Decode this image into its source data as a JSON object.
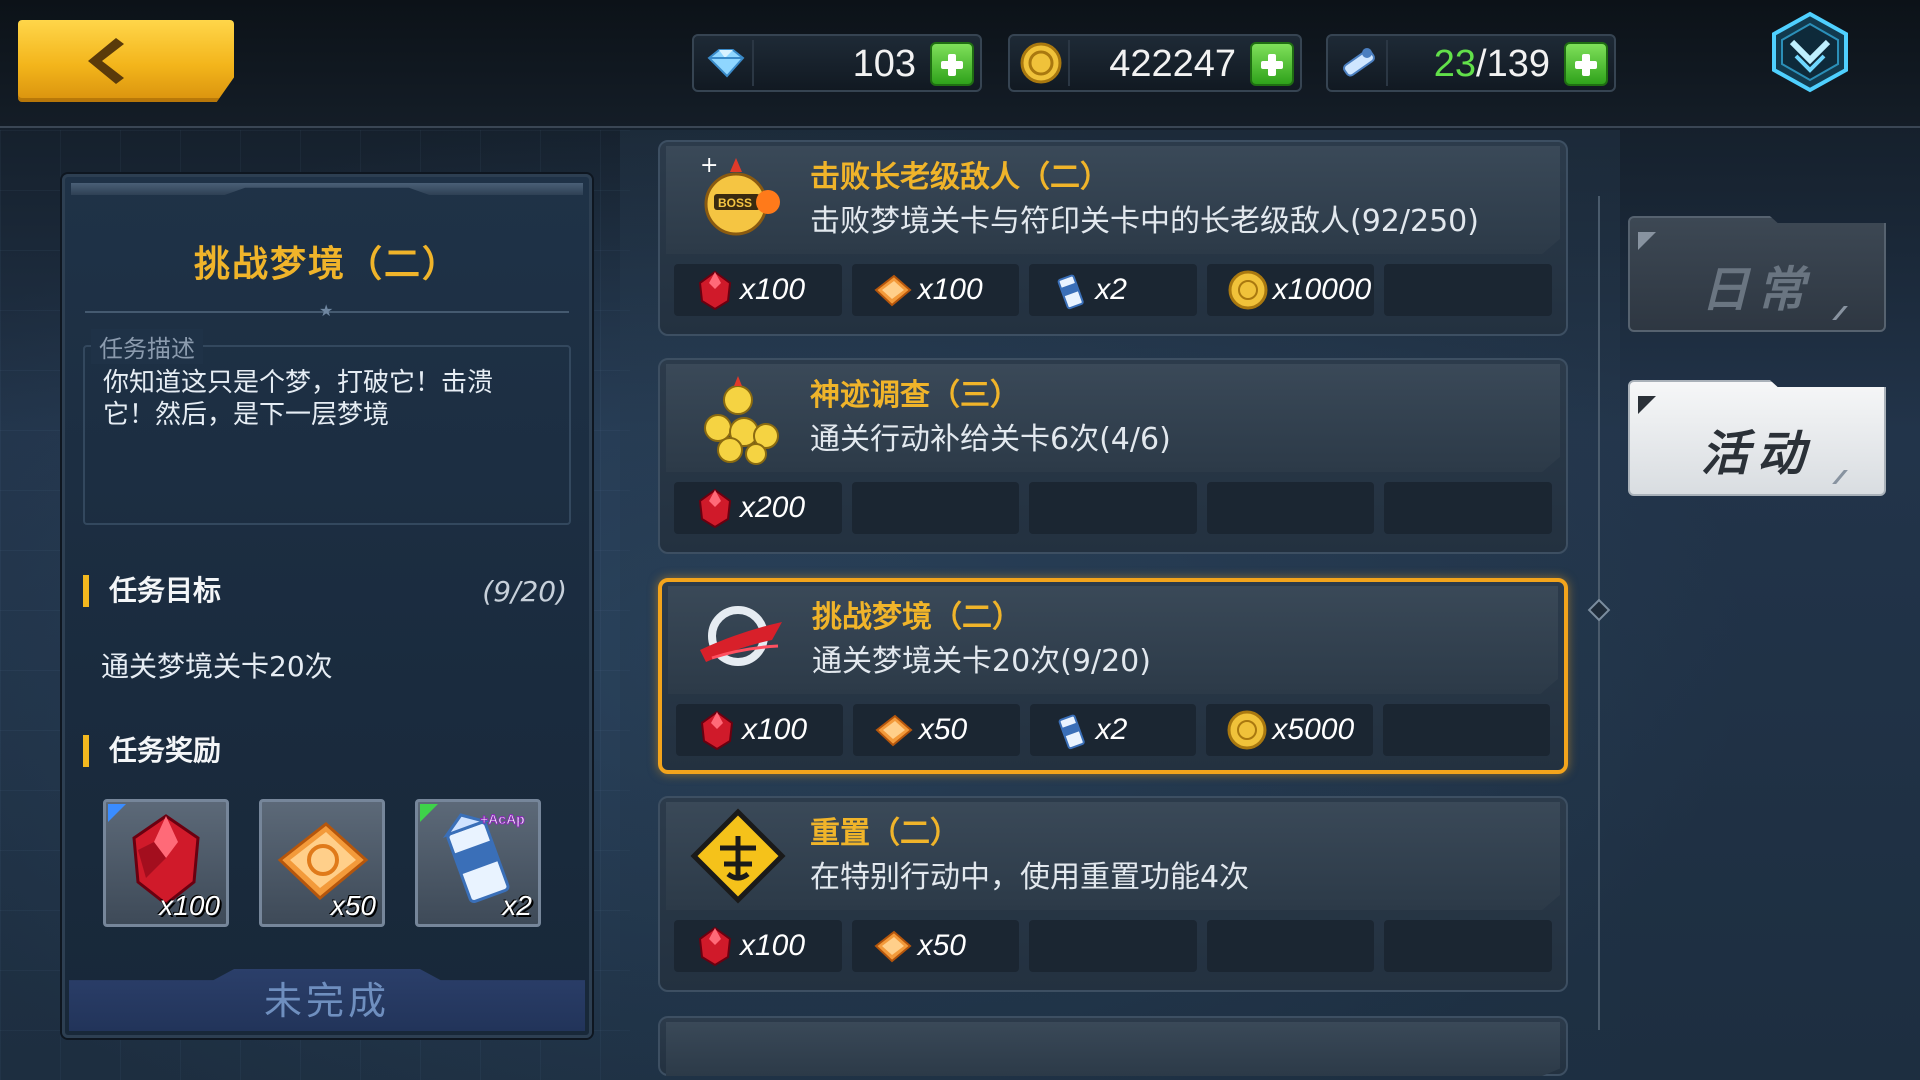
{
  "topbar": {
    "resources": [
      {
        "icon": "crystal-icon",
        "value": "103"
      },
      {
        "icon": "coin-icon",
        "value": "422247"
      },
      {
        "icon": "stamina-icon",
        "current": "23",
        "max": "/139"
      }
    ]
  },
  "detail": {
    "title": "挑战梦境（二）",
    "desc_label": "任务描述",
    "desc_text": "你知道这只是个梦，打破它！击溃它！然后，是下一层梦境",
    "goal_heading": "任务目标",
    "goal_progress": "(9/20)",
    "goal_text": "通关梦境关卡20次",
    "reward_heading": "任务奖励",
    "rewards": [
      {
        "icon": "red-crystal-icon",
        "qty": "x100"
      },
      {
        "icon": "exp-card-icon",
        "qty": "x50"
      },
      {
        "icon": "milk-carton-icon",
        "qty": "x2"
      }
    ],
    "status": "未完成"
  },
  "quests": [
    {
      "name": "击败长老级敌人（二）",
      "desc": "击败梦境关卡与符印关卡中的长老级敌人(92/250)",
      "icon": "boss-chick-icon",
      "rewards": [
        {
          "icon": "red-crystal-icon",
          "qty": "x100"
        },
        {
          "icon": "exp-card-icon",
          "qty": "x100"
        },
        {
          "icon": "milk-carton-icon",
          "qty": "x2"
        },
        {
          "icon": "coin-icon",
          "qty": "x10000"
        }
      ]
    },
    {
      "name": "神迹调查（三）",
      "desc": "通关行动补给关卡6次(4/6)",
      "icon": "chick-pile-icon",
      "rewards": [
        {
          "icon": "red-crystal-icon",
          "qty": "x200"
        }
      ]
    },
    {
      "name": "挑战梦境（二）",
      "desc": "通关梦境关卡20次(9/20)",
      "icon": "slash-orb-icon",
      "rewards": [
        {
          "icon": "red-crystal-icon",
          "qty": "x100"
        },
        {
          "icon": "exp-card-icon",
          "qty": "x50"
        },
        {
          "icon": "milk-carton-icon",
          "qty": "x2"
        },
        {
          "icon": "coin-icon",
          "qty": "x5000"
        }
      ]
    },
    {
      "name": "重置（二）",
      "desc": "在特别行动中，使用重置功能4次",
      "icon": "reset-sign-icon",
      "rewards": [
        {
          "icon": "red-crystal-icon",
          "qty": "x100"
        },
        {
          "icon": "exp-card-icon",
          "qty": "x50"
        }
      ]
    }
  ],
  "tabs": [
    {
      "label": "日常",
      "active": false
    },
    {
      "label": "活动",
      "active": true
    }
  ],
  "colors": {
    "accent_gold": "#f0b42a",
    "active_border": "#f3a41c",
    "plus_green": "#2fa21b"
  }
}
